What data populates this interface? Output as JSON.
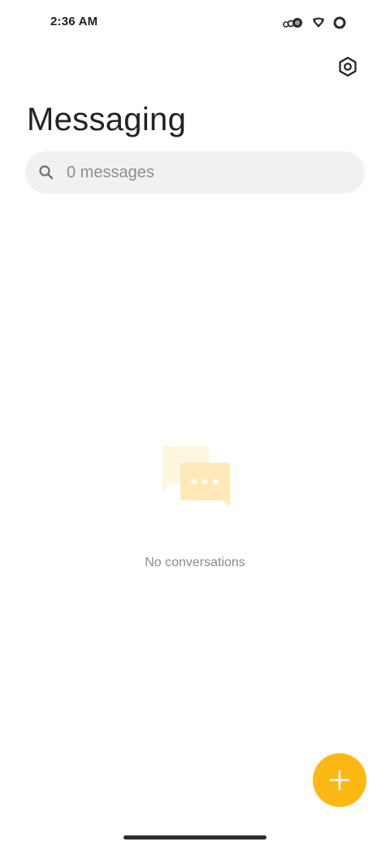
{
  "status_bar": {
    "time": "2:36 AM",
    "icons": [
      "notification-dots-icon",
      "shield-icon",
      "circle-status-icon"
    ]
  },
  "header": {
    "title": "Messaging",
    "settings_icon": "settings-hexagon-icon"
  },
  "search": {
    "placeholder": "0 messages",
    "icon": "search-icon"
  },
  "empty_state": {
    "illustration": "chat-bubbles-icon",
    "message": "No conversations"
  },
  "fab": {
    "icon": "plus-icon",
    "color": "#fdb813"
  },
  "colors": {
    "accent": "#fdb813",
    "search_bg": "#f1f1f1",
    "illustration_light": "#fff6e0",
    "illustration_mid": "#ffe9b8"
  }
}
